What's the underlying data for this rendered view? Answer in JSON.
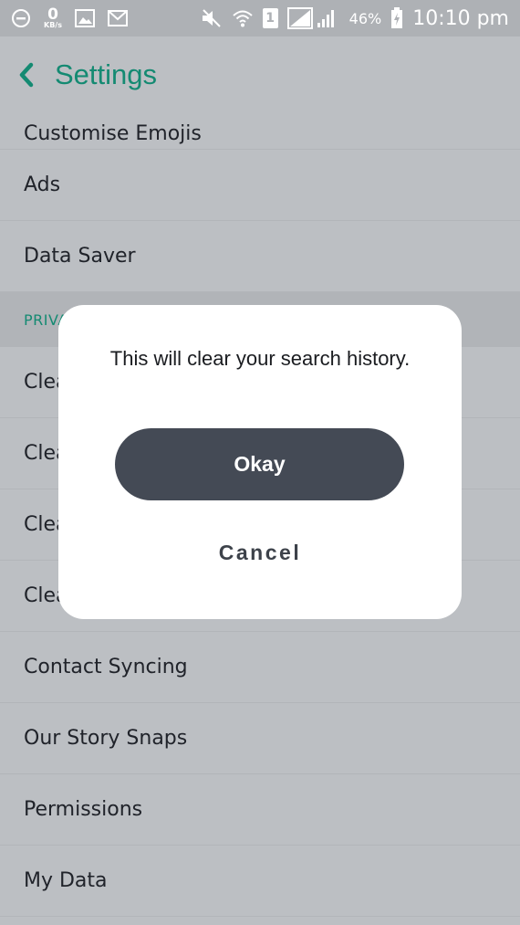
{
  "status_bar": {
    "net_speed_value": "0",
    "net_speed_unit": "KB/s",
    "sim_number": "1",
    "battery_percent": "46%",
    "time": "10:10 pm",
    "icons": [
      "minus-circle-icon",
      "image-icon",
      "mail-icon",
      "mute-icon",
      "wifi-icon",
      "sim-icon",
      "signal-icon",
      "battery-charging-icon"
    ]
  },
  "header": {
    "title": "Settings",
    "back_icon": "chevron-left-icon",
    "accent_color": "#148a72"
  },
  "list": {
    "top_partial": "Customise Emojis",
    "items_top": [
      "Ads",
      "Data Saver"
    ],
    "section_label": "PRIVACY",
    "clear_items": [
      "Clear",
      "Clear",
      "Clear",
      "Clear"
    ],
    "items_bottom": [
      "Contact Syncing",
      "Our Story Snaps",
      "Permissions",
      "My Data"
    ]
  },
  "dialog": {
    "message": "This will clear your search history.",
    "confirm_label": "Okay",
    "cancel_label": "Cancel"
  }
}
